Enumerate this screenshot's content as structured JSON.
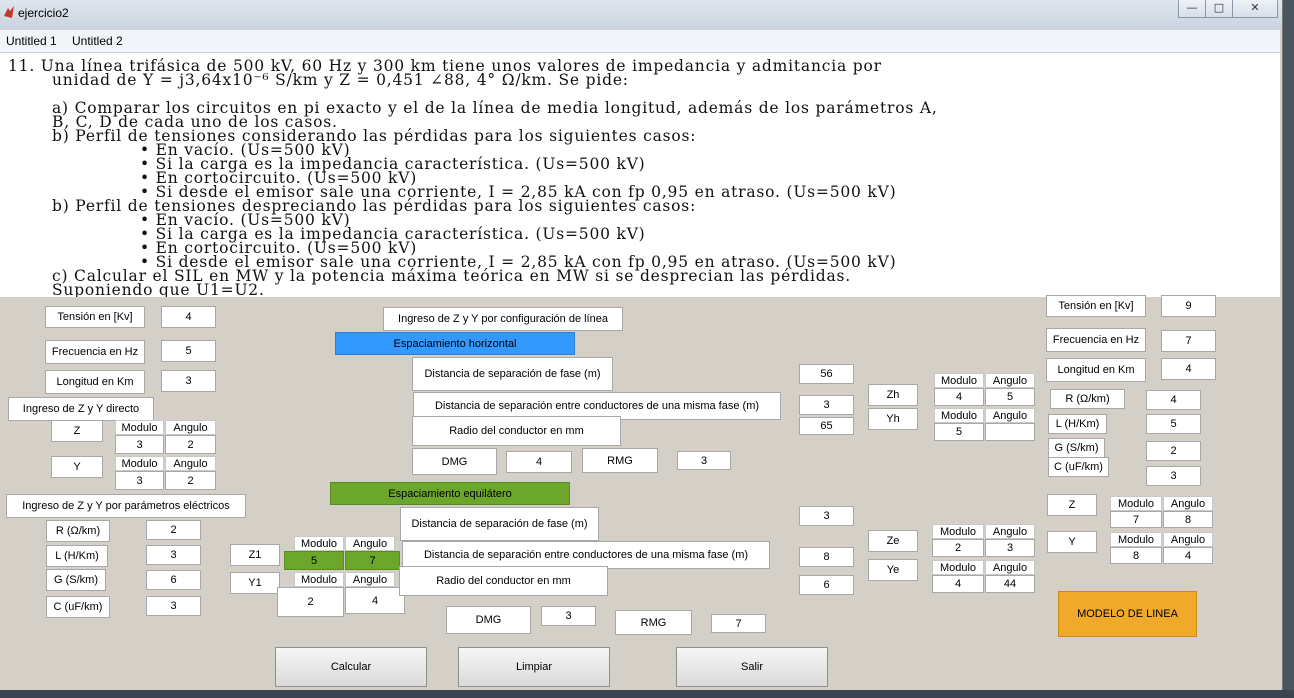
{
  "window": {
    "title": "ejercicio2",
    "minimize": "—",
    "maximize": "□",
    "close": "✕"
  },
  "menu": [
    "Untitled 1",
    "Untitled 2"
  ],
  "problem": {
    "l1": "11. Una línea trifásica de 500 kV, 60 Hz y 300 km tiene unos valores de impedancia y admitancia por",
    "l2": "unidad de Y = j3,64x10⁻⁶ S/km y Z = 0,451 ∠88, 4° Ω/km. Se pide:",
    "l3": "a) Comparar los circuitos en pi exacto y el de la línea de media longitud, además de los parámetros A,",
    "l4": "B, C, D de cada uno de los casos.",
    "l5": "b) Perfil de tensiones considerando las pérdidas para los siguientes casos:",
    "l6": "• En vacío. (Us=500 kV)",
    "l7": "• Si la carga es la impedancia característica. (Us=500 kV)",
    "l8": "• En cortocircuito. (Us=500 kV)",
    "l9": "• Si desde el emisor sale una corriente, I = 2,85 kA con fp 0,95 en atraso. (Us=500 kV)",
    "l10": "b) Perfil de tensiones despreciando las pérdidas para los siguientes casos:",
    "l11": "• En vacío. (Us=500 kV)",
    "l12": "• Si la carga es la impedancia característica. (Us=500 kV)",
    "l13": "• En cortocircuito. (Us=500 kV)",
    "l14": "• Si desde el emisor sale una corriente, I = 2,85 kA con fp 0,95 en atraso. (Us=500 kV)",
    "l15": "c) Calcular el SIL en MW y la potencia máxima teórica en MW si se desprecian las pérdidas.",
    "l16": "Suponiendo que U1=U2."
  },
  "left": {
    "tension_label": "Tensión en [Kv]",
    "tension": "4",
    "freq_label": "Frecuencia en Hz",
    "freq": "5",
    "long_label": "Longitud en Km",
    "long": "3",
    "directo_title": "Ingreso de Z y Y directo",
    "modulo": "Modulo",
    "angulo": "Angulo",
    "z_label": "Z",
    "z_mod": "3",
    "z_ang": "2",
    "y_label": "Y",
    "y_mod": "3",
    "y_ang": "2",
    "param_title": "Ingreso de Z y Y por parámetros eléctricos",
    "r_label": "R (Ω/km)",
    "r": "2",
    "l_label": "L (H/Km)",
    "l": "3",
    "g_label": "G (S/km)",
    "g": "6",
    "c_label": "C (uF/km)",
    "c": "3",
    "z1_label": "Z1",
    "z1_mod": "5",
    "z1_ang": "7",
    "y1_label": "Y1",
    "y1_mod": "2",
    "y1_ang": "4"
  },
  "middle": {
    "config_title": "Ingreso de Z y Y por configuración de línea",
    "horizontal": "Espaciamiento horizontal",
    "h_dist_fase_label": "Distancia de separación de fase (m)",
    "h_dist_fase": "56",
    "h_dist_cond_label": "Distancia de separación entre conductores de una misma fase (m)",
    "h_dist_cond": "3",
    "h_radio_label": "Radio del conductor en mm",
    "h_radio": "65",
    "dmg_label": "DMG",
    "h_dmg": "4",
    "rmg_label": "RMG",
    "h_rmg": "3",
    "equilatero": "Espaciamiento equilátero",
    "e_dist_fase_label": "Distancia de separación de fase (m)",
    "e_dist_fase": "3",
    "e_dist_cond_label": "Distancia de separación entre conductores de una misma fase (m)",
    "e_dist_cond": "8",
    "e_radio_label": "Radio del conductor en mm",
    "e_radio": "6",
    "e_dmg": "3",
    "e_rmg": "7",
    "zh_label": "Zh",
    "zh_mod": "4",
    "zh_ang": "5",
    "yh_label": "Yh",
    "yh_mod": "5",
    "yh_ang": "",
    "ze_label": "Ze",
    "ze_mod": "2",
    "ze_ang": "3",
    "ye_label": "Ye",
    "ye_mod": "4",
    "ye_ang": "44"
  },
  "right": {
    "tension_label": "Tensión en [Kv]",
    "tension": "9",
    "freq_label": "Frecuencia en Hz",
    "freq": "7",
    "long_label": "Longitud en Km",
    "long": "4",
    "r_label": "R (Ω/km)",
    "r": "4",
    "l_label": "L (H/Km)",
    "l": "5",
    "g_label": "G (S/km)",
    "g": "2",
    "c_label": "C (uF/km)",
    "c": "3",
    "z_label": "Z",
    "z_mod": "7",
    "z_ang": "8",
    "y_label": "Y",
    "y_mod": "8",
    "y_ang": "4",
    "modelo": "MODELO DE LINEA"
  },
  "buttons": {
    "calcular": "Calcular",
    "limpiar": "Limpiar",
    "salir": "Salir"
  },
  "colors": {
    "blue": "#3399ff",
    "green": "#6ca62b",
    "orange": "#f0a92a"
  }
}
